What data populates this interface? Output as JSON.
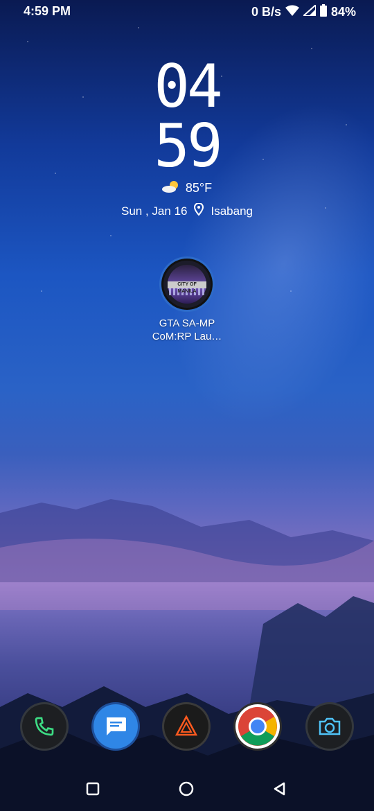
{
  "status_bar": {
    "time": "4:59 PM",
    "network_speed": "0 B/s",
    "battery": "84%",
    "icons": [
      "wifi-icon",
      "signal-icon",
      "battery-icon"
    ]
  },
  "clock": {
    "hours": "04",
    "minutes": "59"
  },
  "weather": {
    "icon": "partly-cloudy-icon",
    "temperature": "85°F"
  },
  "date_location": {
    "date": "Sun , Jan 16",
    "location_icon": "location-pin-icon",
    "location": "Isabang"
  },
  "home_app": {
    "label": "GTA SA-MP\nCoM:RP Lau…",
    "label_line1": "GTA SA-MP",
    "label_line2": "CoM:RP Lau…",
    "icon": "city-of-manila-icon",
    "icon_text": "CITY OF MANILA"
  },
  "dock": {
    "apps": [
      "phone-icon",
      "messages-icon",
      "aura-icon",
      "chrome-icon",
      "camera-icon"
    ]
  },
  "nav_bar": {
    "buttons": [
      "recents-button",
      "home-button",
      "back-button"
    ]
  },
  "colors": {
    "accent": "#2f86e6",
    "phone_green": "#3ddc84",
    "aura_orange": "#ff5a1f"
  }
}
